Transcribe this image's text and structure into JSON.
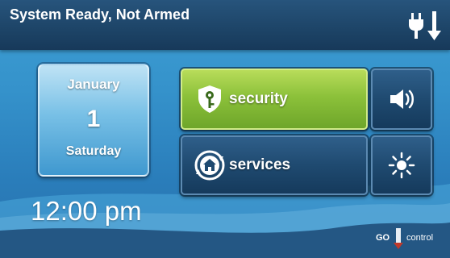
{
  "status": {
    "text": "System Ready, Not Armed",
    "power_icon": "power-plug-arrow-down-icon"
  },
  "date": {
    "month": "January",
    "day": "1",
    "weekday": "Saturday"
  },
  "clock": {
    "time": "12:00 pm"
  },
  "buttons": {
    "security": {
      "label": "security",
      "icon": "shield-key-icon",
      "color": "#8cc13a"
    },
    "services": {
      "label": "services",
      "icon": "home-cycle-icon",
      "color": "#1f4a70"
    },
    "volume": {
      "icon": "speaker-volume-icon"
    },
    "brightness": {
      "icon": "sun-brightness-icon"
    }
  },
  "logo": {
    "part1": "GO",
    "part2": "control"
  },
  "colors": {
    "header": "#1d4467",
    "background": "#3592cb",
    "accent_green": "#8cc13a"
  }
}
